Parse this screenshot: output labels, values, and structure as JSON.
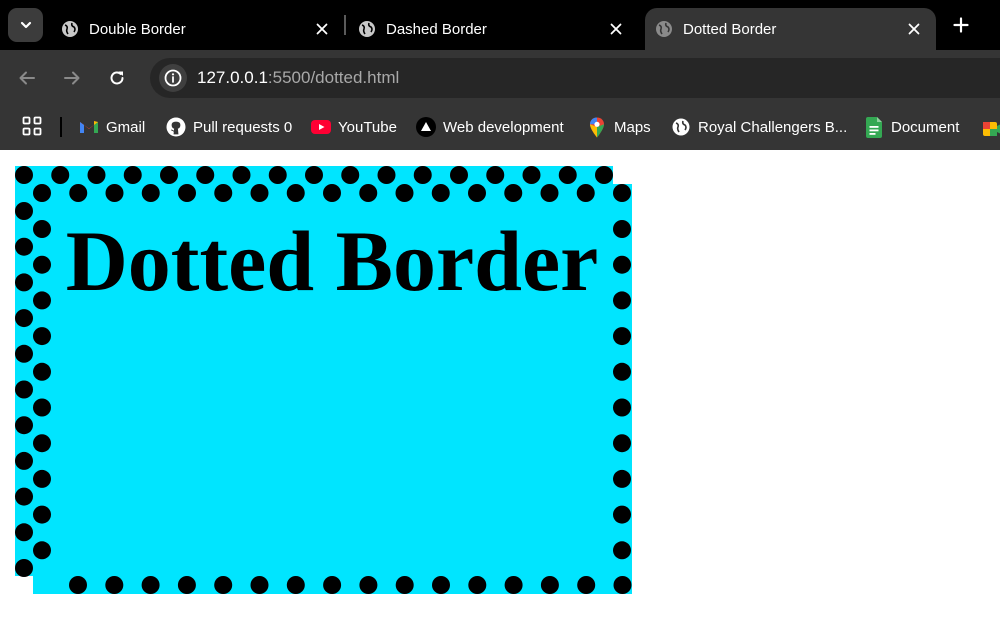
{
  "tabs": [
    {
      "title": "Double Border",
      "active": false
    },
    {
      "title": "Dashed Border",
      "active": false
    },
    {
      "title": "Dotted Border",
      "active": true
    }
  ],
  "toolbar": {
    "url_host": "127.0.0.1",
    "url_rest": ":5500/dotted.html"
  },
  "bookmarks": [
    {
      "label": "Gmail",
      "icon": "gmail-icon"
    },
    {
      "label": "Pull requests 0",
      "icon": "github-icon"
    },
    {
      "label": "YouTube",
      "icon": "youtube-icon"
    },
    {
      "label": "Web development",
      "icon": "triangle-icon"
    },
    {
      "label": "Maps",
      "icon": "maps-icon"
    },
    {
      "label": "Royal Challengers B...",
      "icon": "globe-icon"
    },
    {
      "label": "Document",
      "icon": "docs-icon"
    }
  ],
  "page": {
    "heading": "Dotted Border",
    "box_background": "#00e5ff",
    "border_color": "#000000",
    "border_style": "dotted"
  }
}
